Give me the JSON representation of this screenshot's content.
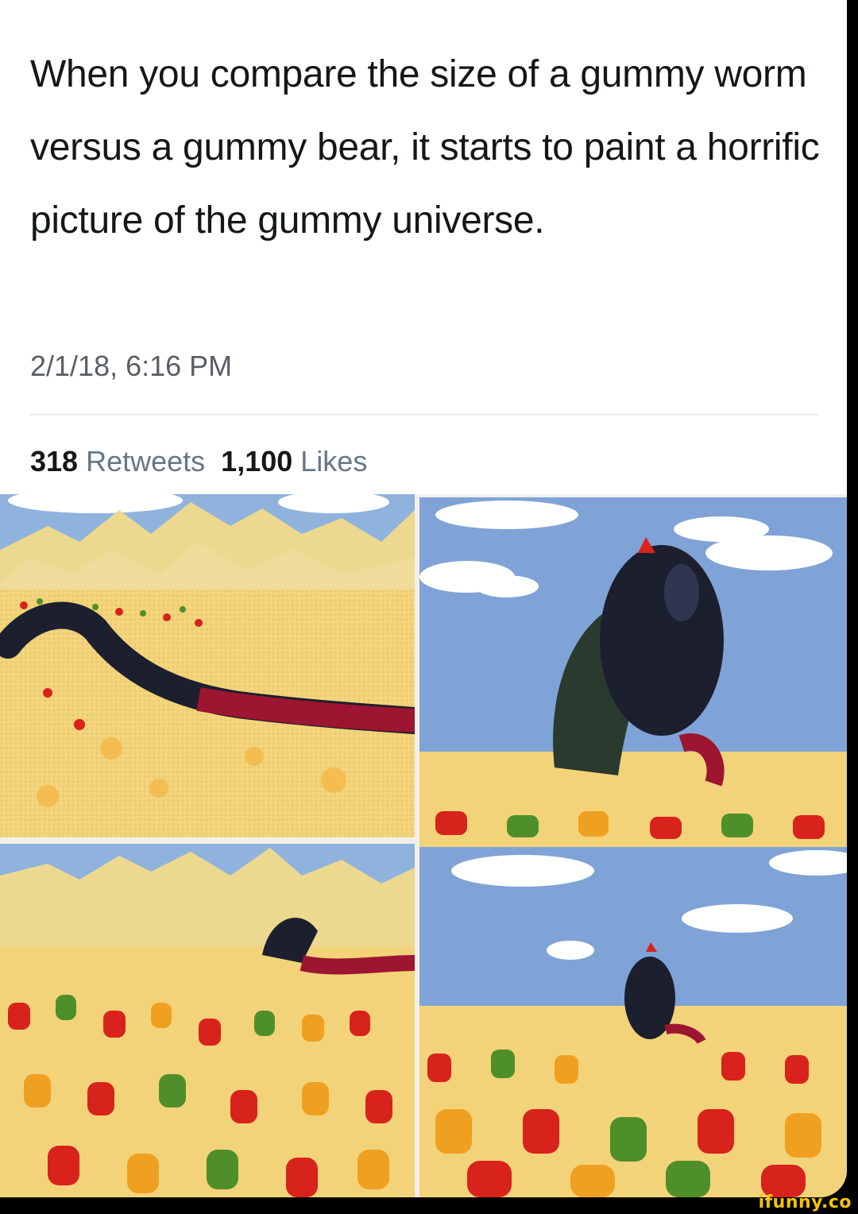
{
  "tweet": {
    "text": "When you compare the size of a gummy worm versus a gummy bear, it starts to paint a horrific picture of the gummy universe.",
    "timestamp": "2/1/18, 6:16 PM",
    "retweets_count": "318",
    "retweets_label": "Retweets",
    "likes_count": "1,100",
    "likes_label": "Likes"
  },
  "watermark": {
    "text": "ifunny.co"
  },
  "colors": {
    "sky": "#7fa3d6",
    "sand": "#f2d37a",
    "worm_dark": "#1c1f2e",
    "worm_red": "#9d1530",
    "gummy_red": "#d8221c",
    "gummy_green": "#4f8f2a",
    "gummy_orange": "#f0a020",
    "watermark": "#f6c400"
  }
}
